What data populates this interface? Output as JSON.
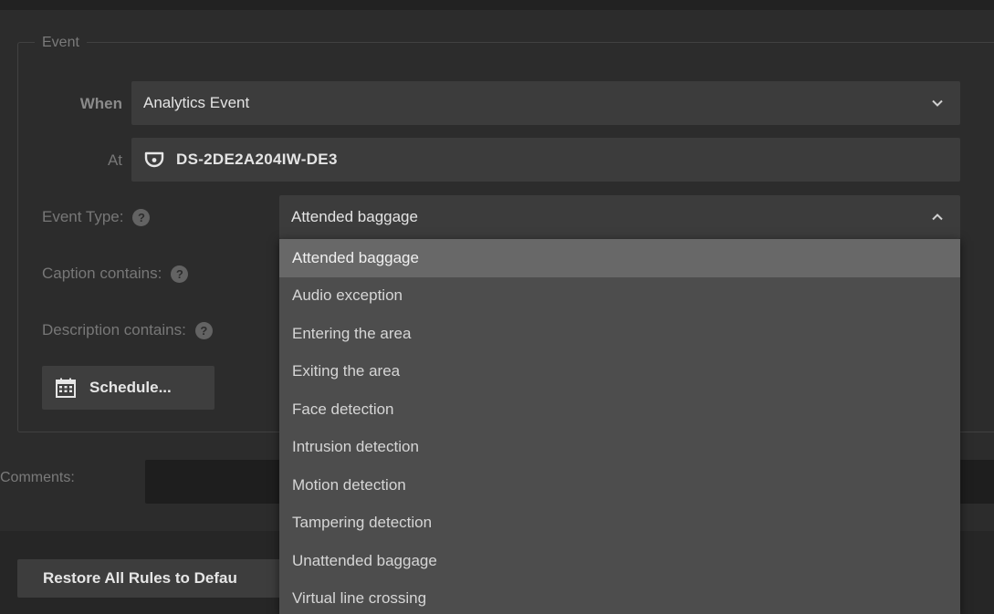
{
  "event_group": {
    "legend": "Event",
    "when": {
      "label": "When",
      "value": "Analytics Event"
    },
    "at": {
      "label": "At",
      "value": "DS-2DE2A204IW-DE3",
      "icon": "camera-icon"
    },
    "event_type": {
      "label": "Event Type:",
      "value": "Attended baggage"
    },
    "caption": {
      "label": "Caption contains:"
    },
    "description": {
      "label": "Description contains:"
    },
    "schedule_button": "Schedule..."
  },
  "help_glyph": "?",
  "comments": {
    "label": "Comments:",
    "value": ""
  },
  "restore_button": "Restore All Rules to Defau",
  "dropdown": {
    "selected_index": 0,
    "options": [
      "Attended baggage",
      "Audio exception",
      "Entering the area",
      "Exiting the area",
      "Face detection",
      "Intrusion detection",
      "Motion detection",
      "Tampering detection",
      "Unattended baggage",
      "Virtual line crossing"
    ]
  },
  "colors": {
    "background": "#2c2c2c",
    "field": "#3c3c3c",
    "dropdown": "#4d4d4d",
    "dropdown_selected": "#686868"
  }
}
